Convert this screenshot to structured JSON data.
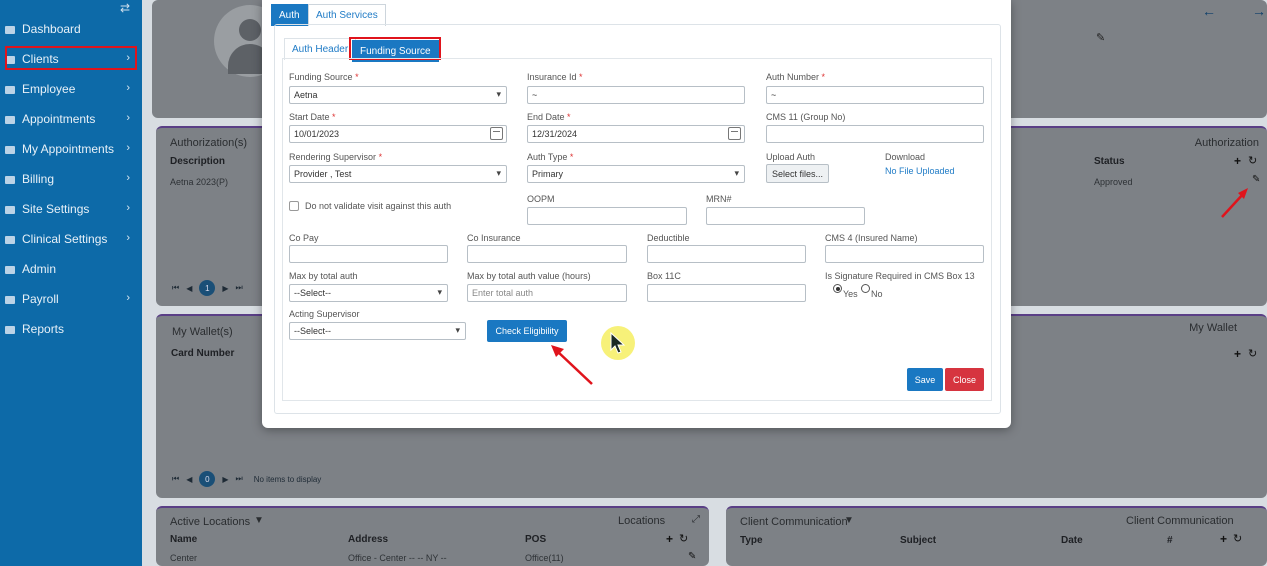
{
  "sidebar": {
    "items": [
      {
        "label": "Dashboard",
        "icon": "dashboard-icon"
      },
      {
        "label": "Clients",
        "icon": "clients-icon",
        "highlighted": true
      },
      {
        "label": "Employee",
        "icon": "employee-icon"
      },
      {
        "label": "Appointments",
        "icon": "calendar-icon"
      },
      {
        "label": "My Appointments",
        "icon": "calendar-icon"
      },
      {
        "label": "Billing",
        "icon": "billing-icon"
      },
      {
        "label": "Site Settings",
        "icon": "settings-icon"
      },
      {
        "label": "Clinical Settings",
        "icon": "clinical-icon"
      },
      {
        "label": "Admin",
        "icon": "admin-icon"
      },
      {
        "label": "Payroll",
        "icon": "payroll-icon"
      },
      {
        "label": "Reports",
        "icon": "reports-icon"
      }
    ]
  },
  "authorization_card": {
    "title": "Authorization(s)",
    "right_title": "Authorization",
    "headers": {
      "description": "Description",
      "status": "Status"
    },
    "row": {
      "description": "Aetna 2023(P)",
      "status": "Approved"
    },
    "page": "1"
  },
  "wallet_card": {
    "title": "My Wallet(s)",
    "right_title": "My Wallet",
    "headers": {
      "card_number": "Card Number"
    },
    "page": "0",
    "empty": "No items to display"
  },
  "locations_card": {
    "title": "Active Locations",
    "right_title": "Locations",
    "headers": {
      "name": "Name",
      "address": "Address",
      "pos": "POS"
    },
    "row": {
      "name": "Center",
      "address": "Office - Center -- -- NY --",
      "pos": "Office(11)"
    }
  },
  "communication_card": {
    "title": "Client Communication",
    "right_title": "Client Communication",
    "headers": {
      "type": "Type",
      "subject": "Subject",
      "date": "Date",
      "num": "#"
    }
  },
  "modal": {
    "tabs": [
      "Auth",
      "Auth Services"
    ],
    "subtabs": [
      "Auth Header",
      "Funding Source"
    ],
    "funding_source": {
      "label": "Funding Source",
      "value": "Aetna"
    },
    "insurance_id": {
      "label": "Insurance Id",
      "value": "~"
    },
    "auth_number": {
      "label": "Auth Number",
      "value": "~"
    },
    "start_date": {
      "label": "Start Date",
      "value": "10/01/2023"
    },
    "end_date": {
      "label": "End Date",
      "value": "12/31/2024"
    },
    "cms11": {
      "label": "CMS 11 (Group No)",
      "value": ""
    },
    "rendering_supervisor": {
      "label": "Rendering Supervisor",
      "value": "Provider , Test"
    },
    "auth_type": {
      "label": "Auth Type",
      "value": "Primary"
    },
    "upload_auth": {
      "label": "Upload Auth",
      "button": "Select files..."
    },
    "download": {
      "label": "Download",
      "link": "No File Uploaded"
    },
    "do_not_validate": "Do not validate visit against this auth",
    "oopm": {
      "label": "OOPM",
      "value": ""
    },
    "mrn": {
      "label": "MRN#",
      "value": ""
    },
    "co_pay": {
      "label": "Co Pay",
      "value": ""
    },
    "co_insurance": {
      "label": "Co Insurance",
      "value": ""
    },
    "deductible": {
      "label": "Deductible",
      "value": ""
    },
    "cms4": {
      "label": "CMS 4 (Insured Name)",
      "value": ""
    },
    "max_total_auth": {
      "label": "Max by total auth",
      "value": "--Select--"
    },
    "max_total_auth_value": {
      "label": "Max by total auth value (hours)",
      "placeholder": "Enter total auth"
    },
    "box11c": {
      "label": "Box 11C",
      "value": ""
    },
    "signature": {
      "label": "Is Signature Required in CMS Box 13",
      "yes": "Yes",
      "no": "No"
    },
    "acting_supervisor": {
      "label": "Acting Supervisor",
      "value": "--Select--"
    },
    "check_eligibility": "Check Eligibility",
    "save": "Save",
    "close": "Close"
  },
  "required_mark": "*",
  "colors": {
    "sidebar": "#0d6aa8",
    "primary": "#1a78c2",
    "danger": "#d6343f",
    "annotation": "#e0141c",
    "cursor_highlight": "#f6f06a"
  }
}
